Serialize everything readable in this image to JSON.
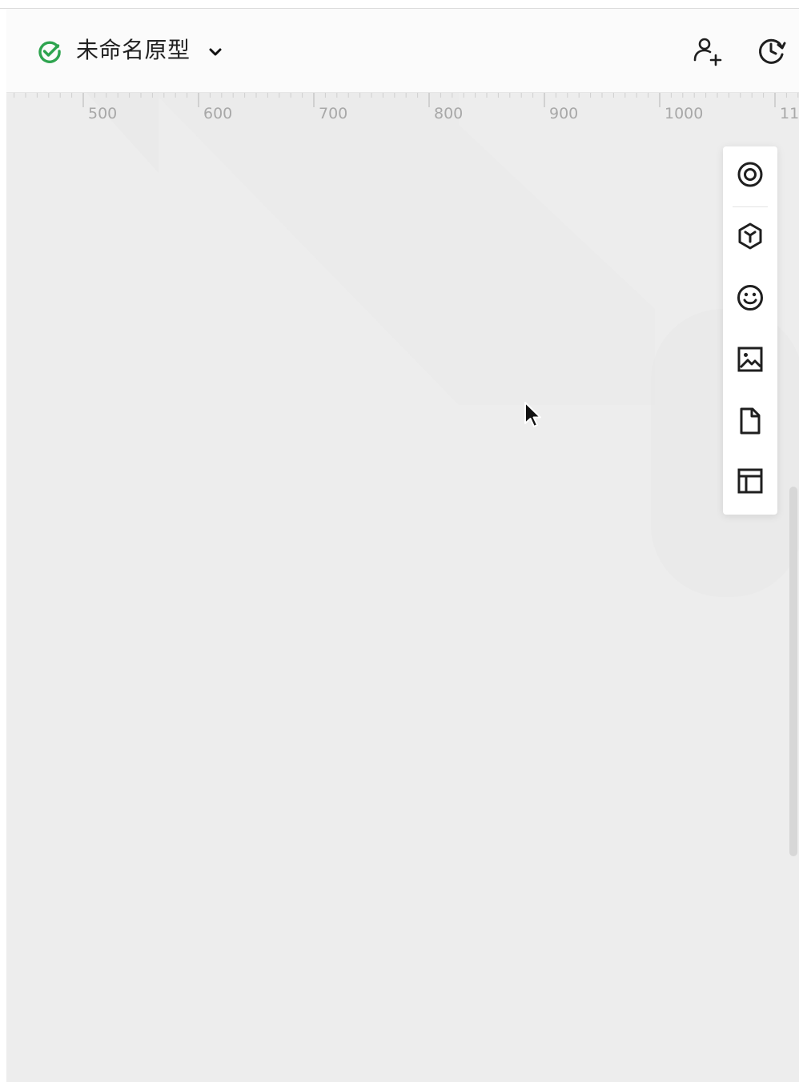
{
  "header": {
    "title": "未命名原型",
    "status_icon": "check-circle-icon",
    "actions": [
      {
        "name": "add-user-icon"
      },
      {
        "name": "history-icon"
      }
    ]
  },
  "ruler": {
    "labels": [
      "500",
      "600",
      "700",
      "800",
      "900",
      "1000",
      "11"
    ]
  },
  "toolbar": {
    "tools": [
      "target-icon",
      "component-cube-icon",
      "emoji-icon",
      "image-icon",
      "page-icon",
      "layout-icon"
    ]
  },
  "colors": {
    "status_green": "#2ea44f",
    "canvas_bg": "#ededed",
    "icon": "#1f1f1f"
  }
}
